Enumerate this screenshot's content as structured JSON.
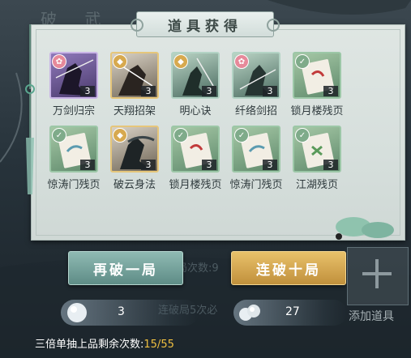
{
  "header": {
    "title": "道具获得"
  },
  "background": {
    "decor_chars": "破 武"
  },
  "items": [
    {
      "name": "万剑归宗",
      "count": "3",
      "rarity": "purple",
      "badge": "red"
    },
    {
      "name": "天翔招架",
      "count": "3",
      "rarity": "gold",
      "badge": "gold"
    },
    {
      "name": "明心诀",
      "count": "3",
      "rarity": "teal",
      "badge": "gold"
    },
    {
      "name": "纤络剑招",
      "count": "3",
      "rarity": "teal",
      "badge": "red"
    },
    {
      "name": "锁月楼残页",
      "count": "3",
      "rarity": "green",
      "badge": "green"
    },
    {
      "name": "惊涛门残页",
      "count": "3",
      "rarity": "green",
      "badge": "green"
    },
    {
      "name": "破云身法",
      "count": "3",
      "rarity": "gold",
      "badge": "gold"
    },
    {
      "name": "锁月楼残页",
      "count": "3",
      "rarity": "green",
      "badge": "green"
    },
    {
      "name": "惊涛门残页",
      "count": "3",
      "rarity": "green",
      "badge": "green"
    },
    {
      "name": "江湖残页",
      "count": "3",
      "rarity": "green",
      "badge": "green"
    }
  ],
  "buttons": {
    "retry": "再破一局",
    "ten": "连破十局"
  },
  "ghost_text": {
    "line1": "局次数:9",
    "line2": "连破局5次必"
  },
  "add_item": {
    "label": "添加道具"
  },
  "currency": [
    {
      "icon": "pearl-icon",
      "value": "3"
    },
    {
      "icon": "pearls-icon",
      "value": "27"
    }
  ],
  "footer": {
    "label": "三倍单抽上品剩余次数:",
    "value": "15/55"
  },
  "colors": {
    "retry": "#7aa9a2",
    "ten": "#d9aa52",
    "highlight": "#f0c040"
  }
}
